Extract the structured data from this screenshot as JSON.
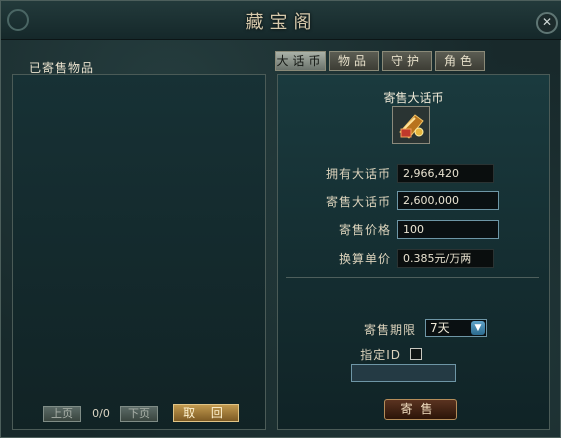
{
  "window": {
    "title": "藏宝阁"
  },
  "left_panel": {
    "label": "已寄售物品",
    "prev_label": "上页",
    "page_count": "0/0",
    "next_label": "下页",
    "cancel_label": "取 回"
  },
  "tabs": [
    {
      "label": "大话币",
      "active": true
    },
    {
      "label": "物品",
      "active": false
    },
    {
      "label": "守护",
      "active": false
    },
    {
      "label": "角色",
      "active": false
    }
  ],
  "sell_form": {
    "heading": "寄售大话币",
    "item_icon": "coin-scroll-icon",
    "owned_label": "拥有大话币",
    "owned_value": "2,966,420",
    "amount_label": "寄售大话币",
    "amount_value": "2,600,000",
    "price_label": "寄售价格",
    "price_value": "100",
    "rate_label": "换算单价",
    "rate_value": "0.385元/万两",
    "period_label": "寄售期限",
    "period_value": "7天",
    "assign_id_label": "指定ID",
    "assign_id_value": "",
    "submit_label": "寄售"
  },
  "colors": {
    "accent": "#c29a4f",
    "input_border": "#6e96a6",
    "panel": "#18292b"
  }
}
